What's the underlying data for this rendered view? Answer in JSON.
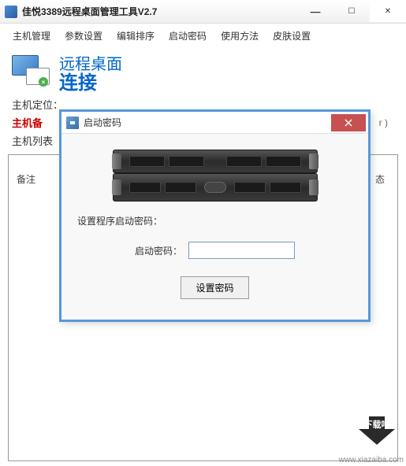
{
  "titlebar": {
    "title": "佳悦3389远程桌面管理工具V2.7"
  },
  "menu": {
    "items": [
      "主机管理",
      "参数设置",
      "编辑排序",
      "启动密码",
      "使用方法",
      "皮肤设置"
    ]
  },
  "header": {
    "line1": "远程桌面",
    "line2": "连接"
  },
  "form": {
    "locate_label": "主机定位：",
    "backup_label": "主机备",
    "list_label": "主机列表",
    "partial_text": "r )"
  },
  "list": {
    "remark": "备注",
    "status": "态"
  },
  "modal": {
    "title": "启动密码",
    "prompt": "设置程序启动密码：",
    "input_label": "启动密码：",
    "button": "设置密码"
  },
  "watermark": {
    "url": "www.xiazaiba.com"
  }
}
